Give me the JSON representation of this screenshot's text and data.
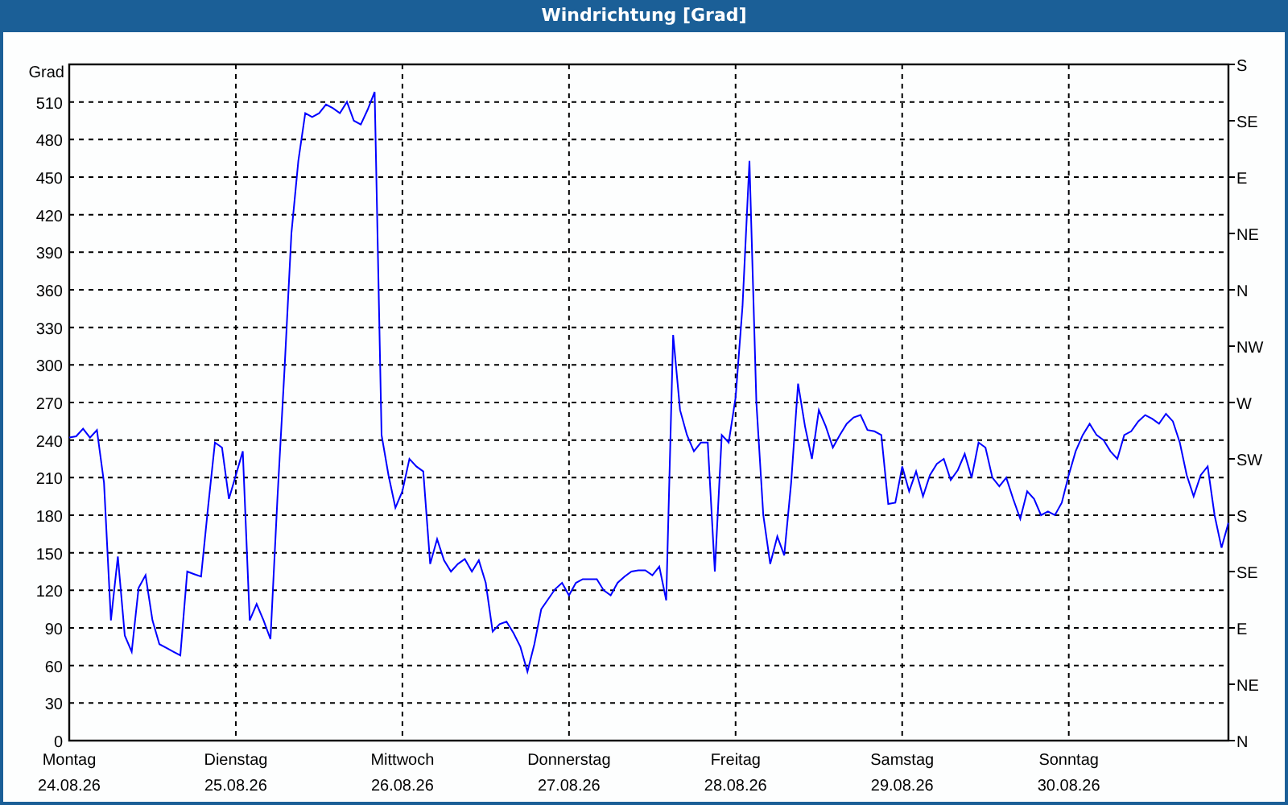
{
  "window": {
    "title": "Windrichtung [Grad]"
  },
  "chart": {
    "compass_labels": [
      "S",
      "SE",
      "E",
      "NE",
      "N",
      "NW",
      "W",
      "SW",
      "S",
      "SE",
      "E",
      "NE",
      "N"
    ],
    "chart_data": {
      "type": "line",
      "grid": true,
      "ylabel": "Grad",
      "ylim": [
        0,
        540
      ],
      "yticks": [
        0,
        30,
        60,
        90,
        120,
        150,
        180,
        210,
        240,
        270,
        300,
        330,
        360,
        390,
        420,
        450,
        480,
        510
      ],
      "categories": [
        "Montag\n24.08.26",
        null,
        null,
        null,
        null,
        null,
        null,
        null,
        null,
        null,
        null,
        null,
        null,
        null,
        null,
        null,
        null,
        null,
        null,
        null,
        null,
        null,
        null,
        null,
        "Dienstag\n25.08.26",
        null,
        null,
        null,
        null,
        null,
        null,
        null,
        null,
        null,
        null,
        null,
        null,
        null,
        null,
        null,
        null,
        null,
        null,
        null,
        null,
        null,
        null,
        null,
        "Mittwoch\n26.08.26",
        null,
        null,
        null,
        null,
        null,
        null,
        null,
        null,
        null,
        null,
        null,
        null,
        null,
        null,
        null,
        null,
        null,
        null,
        null,
        null,
        null,
        null,
        null,
        "Donnerstag\n27.08.26",
        null,
        null,
        null,
        null,
        null,
        null,
        null,
        null,
        null,
        null,
        null,
        null,
        null,
        null,
        null,
        null,
        null,
        null,
        null,
        null,
        null,
        null,
        null,
        "Freitag\n28.08.26",
        null,
        null,
        null,
        null,
        null,
        null,
        null,
        null,
        null,
        null,
        null,
        null,
        null,
        null,
        null,
        null,
        null,
        null,
        null,
        null,
        null,
        null,
        null,
        "Samstag\n29.08.26",
        null,
        null,
        null,
        null,
        null,
        null,
        null,
        null,
        null,
        null,
        null,
        null,
        null,
        null,
        null,
        null,
        null,
        null,
        null,
        null,
        null,
        null,
        null,
        "Sonntag\n30.08.26",
        null,
        null,
        null,
        null,
        null,
        null,
        null,
        null,
        null,
        null,
        null,
        null,
        null,
        null,
        null,
        null,
        null,
        null,
        null,
        null,
        null,
        null,
        null
      ],
      "series": [
        {
          "color": "#0000ff",
          "values": [
            242,
            243,
            249,
            242,
            248,
            206,
            96,
            147,
            84,
            71,
            122,
            132,
            96,
            77,
            74,
            71,
            68,
            135,
            133,
            131,
            186,
            238,
            234,
            193,
            212,
            231,
            96,
            109,
            96,
            81,
            193,
            296,
            405,
            463,
            501,
            498,
            501,
            508,
            505,
            501,
            510,
            495,
            492,
            504,
            518,
            244,
            212,
            186,
            199,
            225,
            219,
            215,
            141,
            161,
            144,
            135,
            141,
            145,
            135,
            144,
            126,
            87,
            93,
            95,
            86,
            75,
            55,
            77,
            105,
            113,
            121,
            126,
            116,
            126,
            129,
            129,
            129,
            120,
            116,
            126,
            131,
            135,
            136,
            136,
            132,
            139,
            112,
            324,
            264,
            244,
            231,
            238,
            238,
            135,
            244,
            238,
            274,
            347,
            463,
            270,
            180,
            141,
            163,
            148,
            206,
            285,
            251,
            225,
            264,
            251,
            234,
            244,
            253,
            258,
            260,
            248,
            247,
            244,
            189,
            190,
            219,
            199,
            215,
            195,
            212,
            221,
            225,
            208,
            216,
            229,
            210,
            238,
            234,
            210,
            203,
            210,
            193,
            177,
            199,
            193,
            180,
            183,
            180,
            190,
            212,
            231,
            244,
            253,
            244,
            240,
            231,
            225,
            244,
            247,
            255,
            260,
            257,
            253,
            261,
            255,
            238,
            212,
            195,
            212,
            219,
            180,
            154,
            174
          ]
        }
      ]
    }
  }
}
